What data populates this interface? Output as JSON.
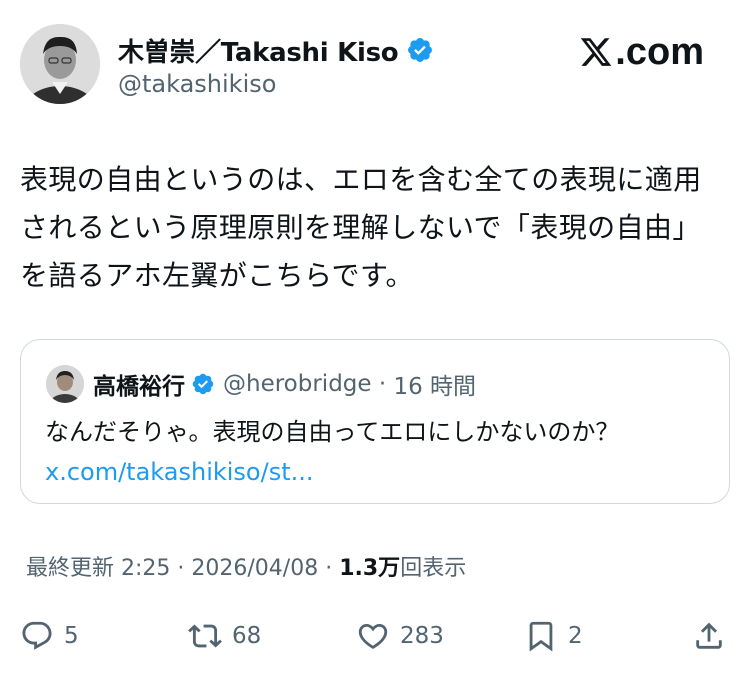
{
  "author": {
    "name": "木曽崇／Takashi Kiso",
    "handle": "@takashikiso"
  },
  "brand": {
    "logo_text": ".com"
  },
  "tweet": {
    "text": "表現の自由というのは、エロを含む全ての表現に適用されるという原理原則を理解しないで「表現の自由」を語るアホ左翼がこちらです。"
  },
  "quote": {
    "name": "高橋裕行",
    "handle": "@herobridge",
    "separator": " · ",
    "time": "16 時間",
    "text": "なんだそりゃ。表現の自由ってエロにしかないのか？",
    "link": "x.com/takashikiso/st..."
  },
  "meta": {
    "updated_label": "最終更新",
    "time": "2:25",
    "date": "2026/04/08",
    "separator1": " · ",
    "separator2": " · ",
    "views_count": "1.3万",
    "views_label": "回表示"
  },
  "actions": {
    "reply_count": "5",
    "repost_count": "68",
    "like_count": "283",
    "bookmark_count": "2"
  },
  "colors": {
    "verified_blue": "#1d9bf0",
    "link_blue": "#1d9bf0",
    "muted_text": "#536471",
    "main_text": "#0f1419",
    "border": "#cfd9de"
  }
}
